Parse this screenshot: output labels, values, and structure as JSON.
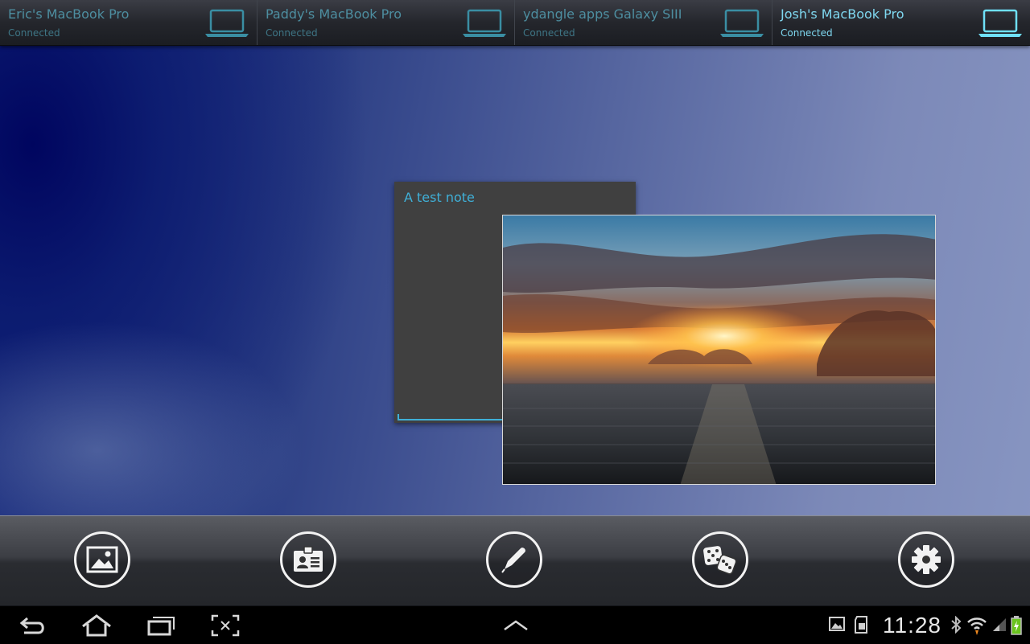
{
  "devices": [
    {
      "name": "Eric's MacBook Pro",
      "status": "Connected",
      "icon": "laptop-icon"
    },
    {
      "name": "Paddy's MacBook Pro",
      "status": "Connected",
      "icon": "laptop-icon"
    },
    {
      "name": "ydangle apps Galaxy SIII",
      "status": "Connected",
      "icon": "laptop-icon"
    },
    {
      "name": "Josh's MacBook Pro",
      "status": "Connected",
      "icon": "laptop-icon",
      "active": true
    }
  ],
  "note": {
    "title": "A test note"
  },
  "action_bar": {
    "buttons": [
      "image-icon",
      "contact-card-icon",
      "pen-icon",
      "dice-icon",
      "gear-icon"
    ]
  },
  "system_bar": {
    "clock": "11:28",
    "nav_icons": [
      "back-icon",
      "home-icon",
      "recent-apps-icon",
      "screenshot-icon",
      "chevron-up-icon"
    ],
    "status_icons": [
      "gallery-notification-icon",
      "sd-card-icon",
      "bluetooth-icon",
      "wifi-icon",
      "signal-icon",
      "battery-charging-icon"
    ]
  },
  "colors": {
    "accent": "#3fb0d8",
    "active_device": "#7fd8f0",
    "inactive_device": "#4d8ea0"
  }
}
